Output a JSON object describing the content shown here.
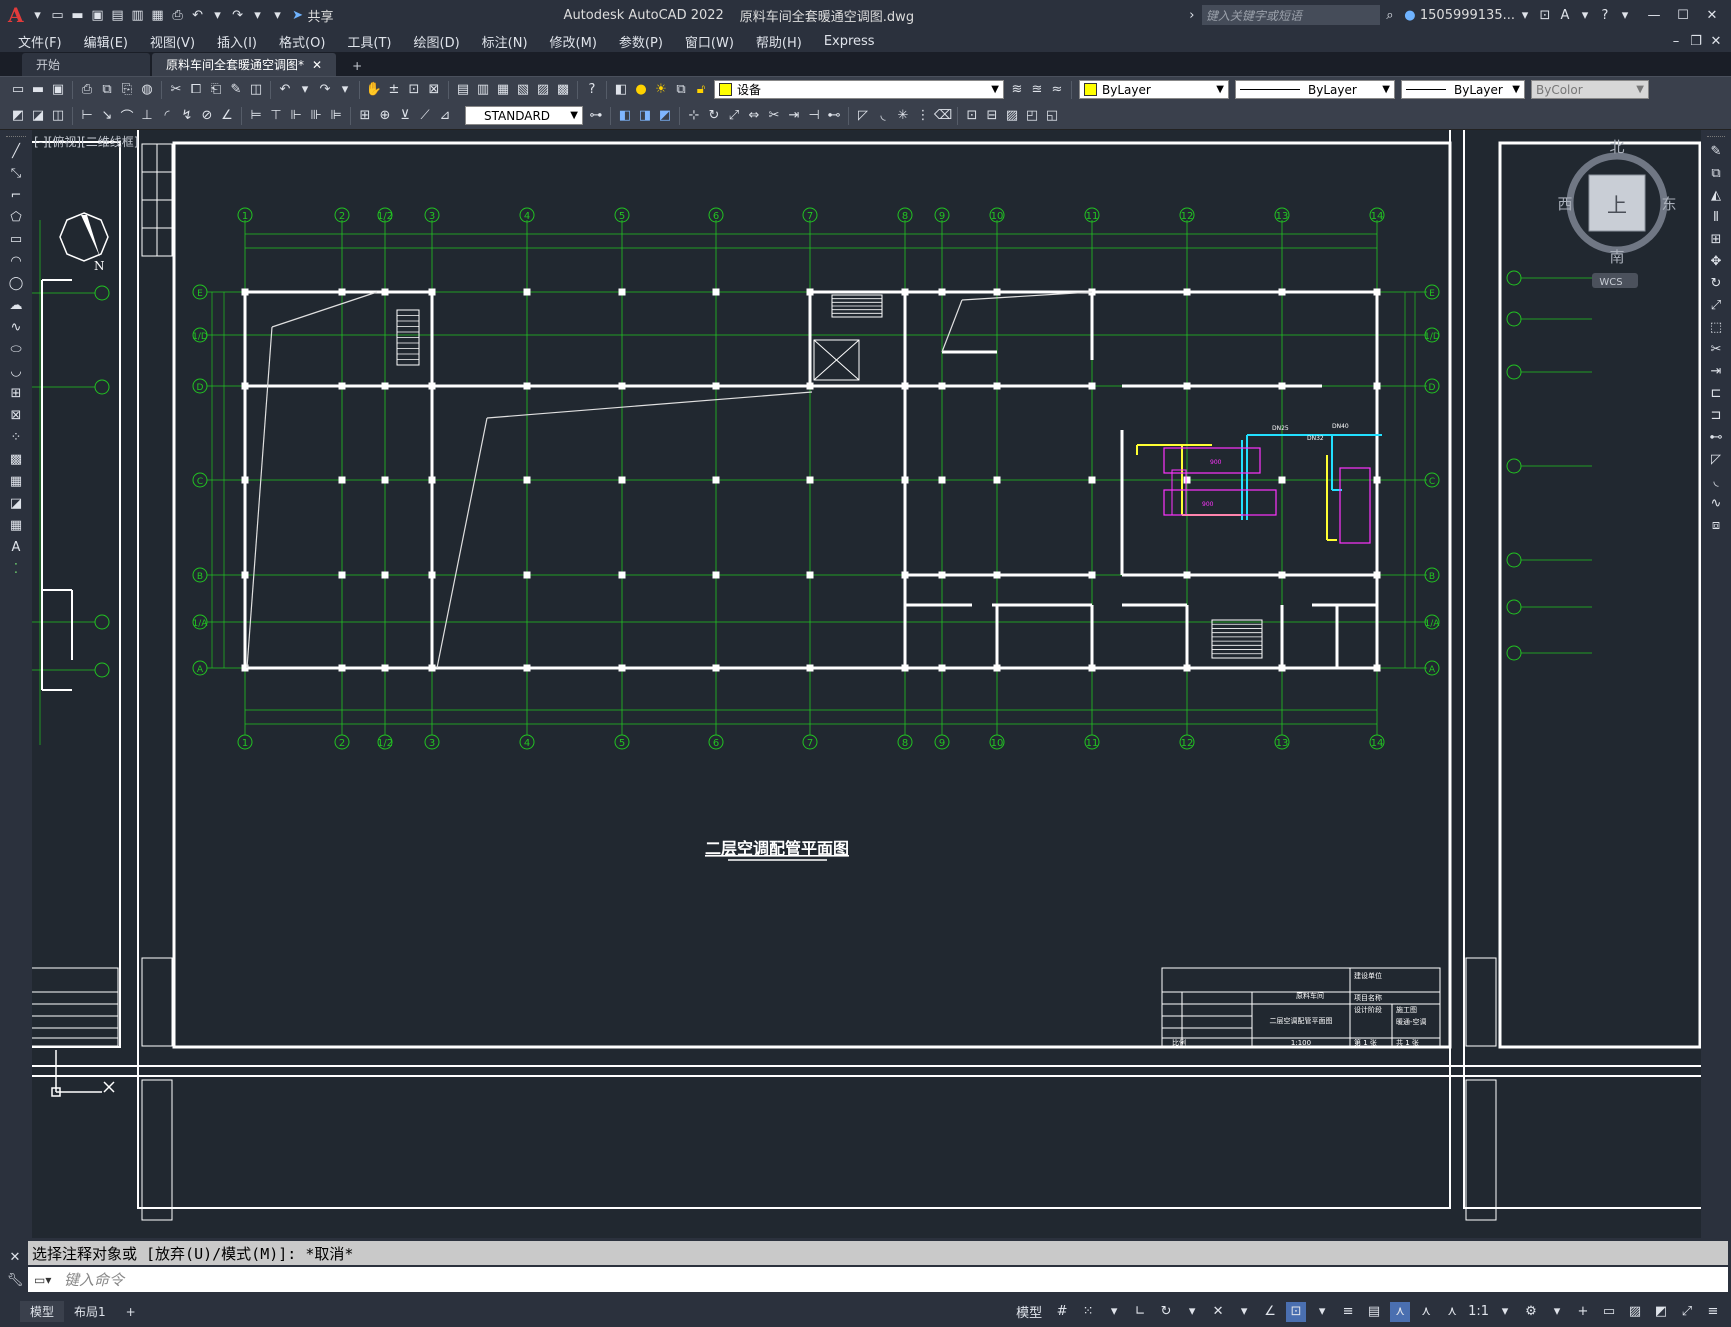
{
  "title": {
    "app": "Autodesk AutoCAD 2022",
    "file": "原料车间全套暖通空调图.dwg",
    "share": "共享",
    "search_placeholder": "键入关键字或短语",
    "user": "1505999135..."
  },
  "menu": [
    "文件(F)",
    "编辑(E)",
    "视图(V)",
    "插入(I)",
    "格式(O)",
    "工具(T)",
    "绘图(D)",
    "标注(N)",
    "修改(M)",
    "参数(P)",
    "窗口(W)",
    "帮助(H)",
    "Express"
  ],
  "tabs": {
    "start": "开始",
    "doc": "原料车间全套暖通空调图*"
  },
  "toolbar": {
    "layer": "设备",
    "color": "ByLayer",
    "linetype": "ByLayer",
    "lineweight": "ByLayer",
    "plotstyle": "ByColor",
    "textstyle": "STANDARD"
  },
  "viewport_label": "[-][俯视][二维线框]",
  "viewcube": {
    "north": "北",
    "south": "南",
    "east": "东",
    "west": "西",
    "top": "上",
    "wcs": "WCS"
  },
  "drawing": {
    "plan_title": "二层空调配管平面图",
    "north_arrow": "N",
    "cols_top": [
      "1",
      "2",
      "1/2",
      "3",
      "4",
      "5",
      "6",
      "7",
      "8",
      "9",
      "10",
      "11",
      "12",
      "13",
      "14"
    ],
    "rows": [
      "E",
      "1/D",
      "D",
      "C",
      "B",
      "1/A",
      "A"
    ],
    "titleblock": {
      "drawing_name": "二层空调配管平面图",
      "scale": "1:100",
      "labels": [
        "建设单位",
        "项目名称",
        "设计阶段",
        "施工图",
        "原料车间",
        "暖通-空调",
        "第 1 张",
        "共 1 张",
        "比例"
      ]
    },
    "equipment_labels": [
      "900",
      "900",
      "DN25",
      "DN32",
      "DN40"
    ]
  },
  "command": {
    "history": "选择注释对象或 [放弃(U)/模式(M)]: *取消*",
    "placeholder": "键入命令"
  },
  "status": {
    "model_tab": "模型",
    "layout_tab": "布局1",
    "model_btn": "模型",
    "scale": "1:1"
  }
}
